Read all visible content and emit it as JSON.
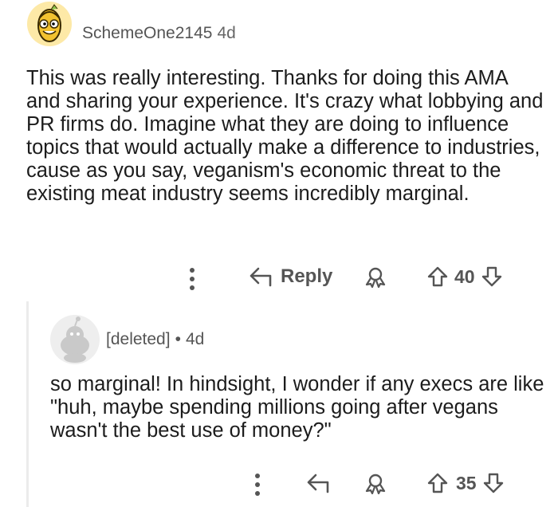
{
  "comment": {
    "username": "SchemeOne2145",
    "age": "4d",
    "body": "This was really interesting. Thanks for doing this AMA and sharing your experience. It's crazy what lobbying and PR firms do. Imagine what they are doing to influence topics that would actually make a difference to industries, cause as you say, veganism's economic threat to the existing meat industry seems incredibly marginal.",
    "reply_label": "Reply",
    "score": "40",
    "icons": [
      "more-options-icon",
      "reply-arrow-icon",
      "award-icon",
      "upvote-icon",
      "downvote-icon"
    ]
  },
  "reply": {
    "username": "[deleted]",
    "separator": "•",
    "age": "4d",
    "body": "so marginal! In hindsight, I wonder if any execs are like \"huh, maybe spending millions going after vegans wasn't the best use of money?\"",
    "score": "35",
    "icons": [
      "more-options-icon",
      "reply-arrow-icon",
      "award-icon",
      "upvote-icon",
      "downvote-icon"
    ]
  },
  "colors": {
    "text": "#1c1c1c",
    "meta": "#555555",
    "icon": "#555555",
    "thread_line": "#ececec"
  }
}
